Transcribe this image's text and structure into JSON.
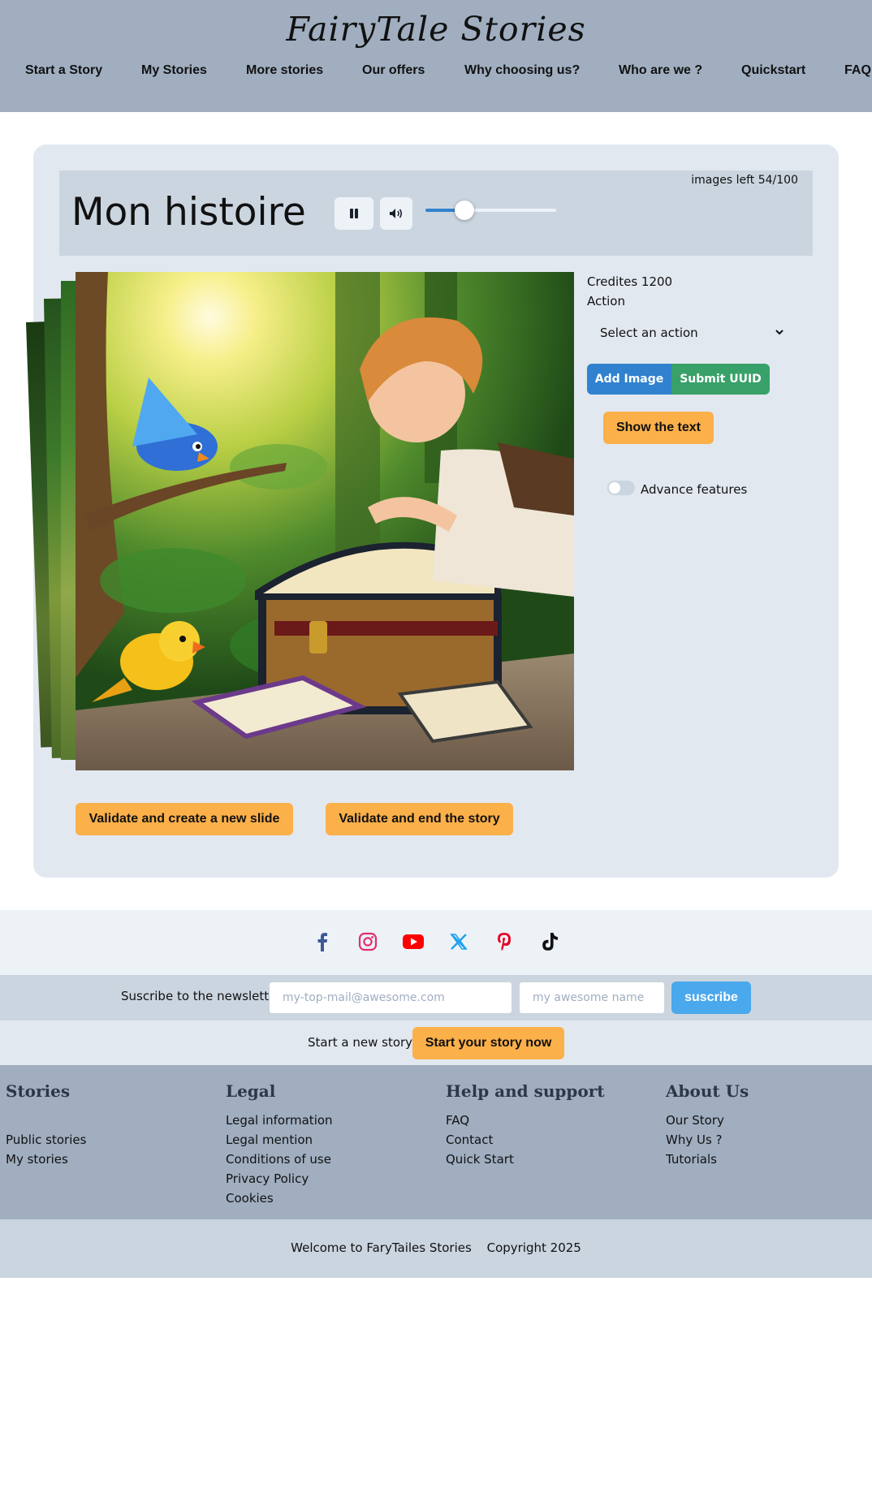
{
  "header": {
    "logo": "FairyTale Stories",
    "nav": [
      "Start a Story",
      "My Stories",
      "More stories",
      "Our offers",
      "Why choosing us?",
      "Who are we ?",
      "Quickstart",
      "FAQ"
    ]
  },
  "story": {
    "images_left": "images left 54/100",
    "title": "Mon histoire",
    "volume_level": 0.3
  },
  "side": {
    "credits": "Credites 1200",
    "action_label": "Action",
    "action_select": "Select an action",
    "add_image": "Add Image",
    "submit_uuid": "Submit UUID",
    "show_text": "Show the text",
    "advance_features": "Advance features"
  },
  "actions": {
    "validate_new": "Validate and create a new slide",
    "validate_end": "Validate and end the story"
  },
  "social": [
    "facebook-icon",
    "instagram-icon",
    "youtube-icon",
    "x-icon",
    "pinterest-icon",
    "tiktok-icon"
  ],
  "newsletter": {
    "label": "Suscribe to the newsletter",
    "email_placeholder": "my-top-mail@awesome.com",
    "name_placeholder": "my awesome name",
    "button": "suscribe"
  },
  "start": {
    "label": "Start a new story",
    "button": "Start your story now"
  },
  "footer": {
    "stories": {
      "title": "Stories",
      "links": [
        "Public stories",
        "My stories"
      ]
    },
    "legal": {
      "title": "Legal",
      "links": [
        "Legal information",
        "Legal mention",
        "Conditions of use",
        "Privacy Policy",
        "Cookies"
      ]
    },
    "help": {
      "title": "Help and support",
      "links": [
        "FAQ",
        "Contact",
        "Quick Start"
      ]
    },
    "about": {
      "title": "About Us",
      "links": [
        "Our Story",
        "Why Us ?",
        "Tutorials"
      ]
    },
    "welcome": "Welcome to FaryTailes Stories",
    "copyright": "Copyright 2025"
  },
  "colors": {
    "header_bg": "#a0aec0",
    "accent_blue": "#3182ce",
    "accent_green": "#38a169",
    "accent_orange": "#fbb04a"
  }
}
